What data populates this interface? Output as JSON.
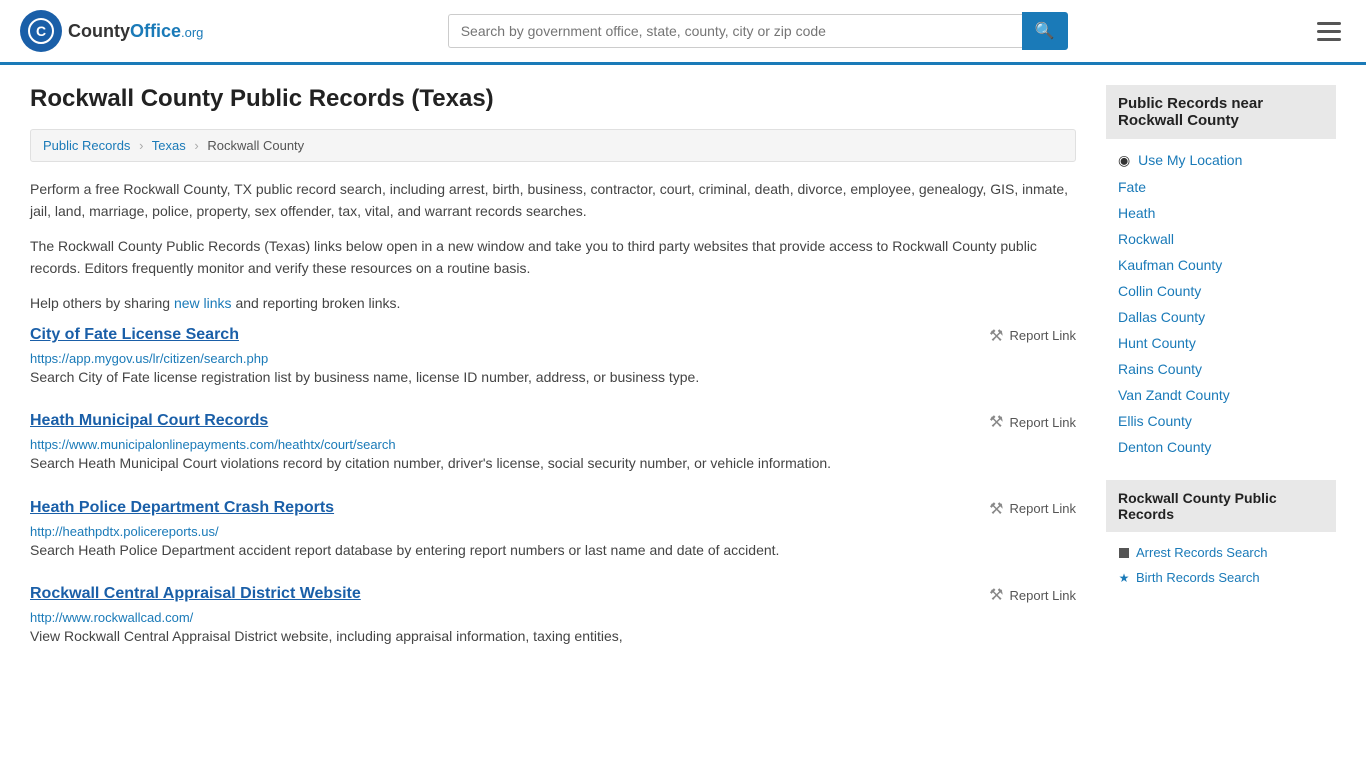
{
  "header": {
    "logo_text": "County",
    "logo_org": ".org",
    "search_placeholder": "Search by government office, state, county, city or zip code"
  },
  "breadcrumb": {
    "items": [
      "Public Records",
      "Texas",
      "Rockwall County"
    ]
  },
  "page": {
    "title": "Rockwall County Public Records (Texas)",
    "description1": "Perform a free Rockwall County, TX public record search, including arrest, birth, business, contractor, court, criminal, death, divorce, employee, genealogy, GIS, inmate, jail, land, marriage, police, property, sex offender, tax, vital, and warrant records searches.",
    "description2": "The Rockwall County Public Records (Texas) links below open in a new window and take you to third party websites that provide access to Rockwall County public records. Editors frequently monitor and verify these resources on a routine basis.",
    "description3_prefix": "Help others by sharing ",
    "new_links_text": "new links",
    "description3_suffix": " and reporting broken links.",
    "report_link_label": "Report Link"
  },
  "records": [
    {
      "title": "City of Fate License Search",
      "url": "https://app.mygov.us/lr/citizen/search.php",
      "description": "Search City of Fate license registration list by business name, license ID number, address, or business type."
    },
    {
      "title": "Heath Municipal Court Records",
      "url": "https://www.municipalonlinepayments.com/heathtx/court/search",
      "description": "Search Heath Municipal Court violations record by citation number, driver's license, social security number, or vehicle information."
    },
    {
      "title": "Heath Police Department Crash Reports",
      "url": "http://heathpdtx.policereports.us/",
      "description": "Search Heath Police Department accident report database by entering report numbers or last name and date of accident."
    },
    {
      "title": "Rockwall Central Appraisal District Website",
      "url": "http://www.rockwallcad.com/",
      "description": "View Rockwall Central Appraisal District website, including appraisal information, taxing entities,"
    }
  ],
  "sidebar": {
    "nearby_title": "Public Records near Rockwall County",
    "use_location_label": "Use My Location",
    "nearby_places": [
      "Fate",
      "Heath",
      "Rockwall",
      "Kaufman County",
      "Collin County",
      "Dallas County",
      "Hunt County",
      "Rains County",
      "Van Zandt County",
      "Ellis County",
      "Denton County"
    ],
    "public_records_title": "Rockwall County Public Records",
    "public_records_links": [
      {
        "label": "Arrest Records Search",
        "type": "square"
      },
      {
        "label": "Birth Records Search",
        "type": "star"
      }
    ]
  }
}
